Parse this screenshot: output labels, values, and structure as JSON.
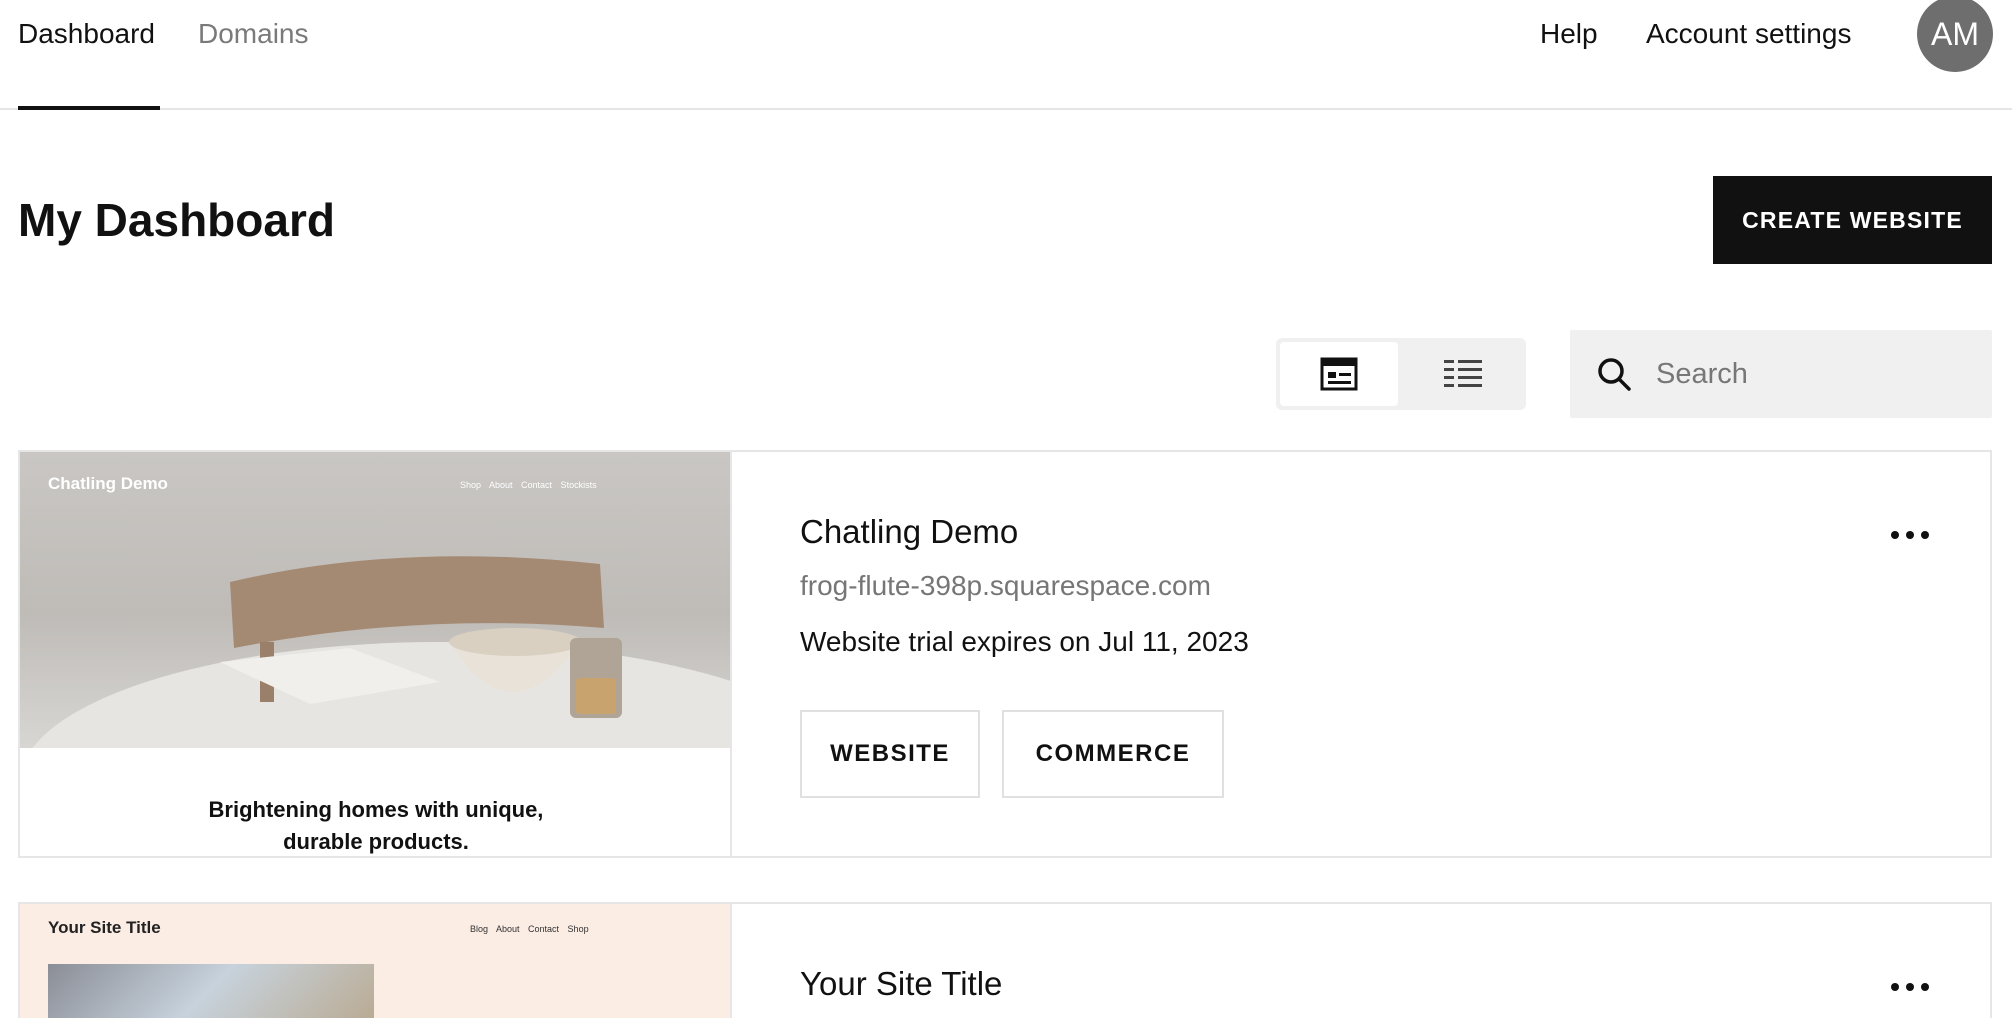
{
  "nav": {
    "tabs": [
      {
        "label": "Dashboard",
        "active": true
      },
      {
        "label": "Domains",
        "active": false
      }
    ],
    "help": "Help",
    "account_settings": "Account settings",
    "avatar_initials": "AM"
  },
  "header": {
    "title": "My Dashboard",
    "create_button": "CREATE WEBSITE"
  },
  "toolbar": {
    "view_options": [
      "grid-view-icon",
      "list-view-icon"
    ],
    "selected_view": "grid",
    "search_placeholder": "Search"
  },
  "sites": [
    {
      "title": "Chatling Demo",
      "url": "frog-flute-398p.squarespace.com",
      "status": "Website trial expires on Jul 11, 2023",
      "buttons": [
        "WEBSITE",
        "COMMERCE"
      ],
      "thumbnail": {
        "site_name": "Chatling Demo",
        "nav": "Shop About Contact Stockists",
        "tagline_line1": "Brightening homes with unique,",
        "tagline_line2": "durable products."
      }
    },
    {
      "title": "Your Site Title",
      "thumbnail": {
        "site_name": "Your Site Title",
        "nav": "Blog About Contact Shop"
      }
    }
  ],
  "colors": {
    "text": "#111111",
    "muted": "#767676",
    "border": "#e6e6e6",
    "button_dark": "#111111",
    "avatar_bg": "#6e6e6e",
    "search_bg": "#f0f0f0"
  }
}
